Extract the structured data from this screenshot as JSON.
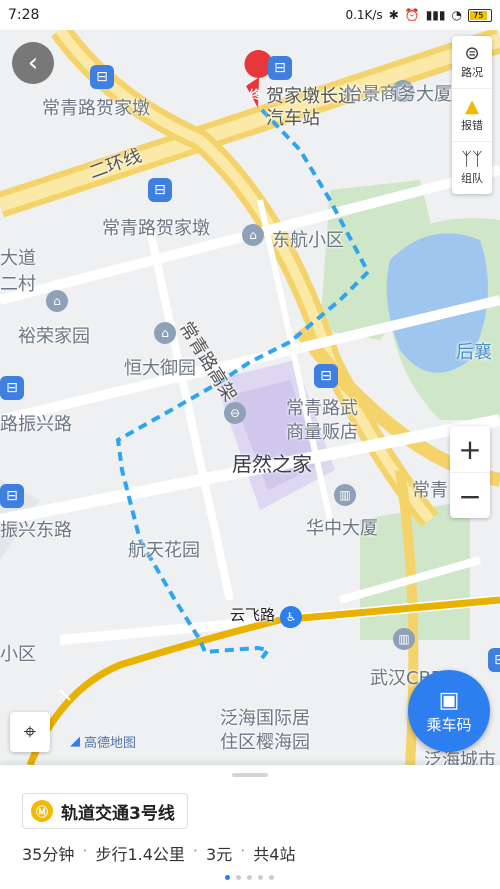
{
  "status": {
    "time": "7:28",
    "net_speed": "0.1K/s",
    "battery": "75"
  },
  "map": {
    "labels": {
      "changqing_hejiadun_1": "常青路贺家墩",
      "hejiadun_bus_station": "贺家墩长途汽车站",
      "yijing": "怡景商务大厦",
      "erhuanxian": "二环线",
      "changqing_hejiadun_2": "常青路贺家墩",
      "donghang": "东航小区",
      "dadao": "大道",
      "ercun": "二村",
      "yurong": "裕荣家园",
      "hengda": "恒大御园",
      "changqing_gaojia": "常青路高架",
      "houxiang": "后襄",
      "lu_zhenxing": "路振兴路",
      "changqing_wu": "常青路武",
      "shangliang": "商量贩店",
      "jurangzhijia": "居然之家",
      "changqing_right": "常青",
      "zhenxing_dong": "振兴东路",
      "hangtian": "航天花园",
      "huazhong": "华中大厦",
      "yunfei": "云飞路",
      "xiaoqu": "小区",
      "wuhan_cbd": "武汉CBD",
      "fanhai": "泛海国际居",
      "fanhai2": "住区樱海园",
      "fanhai_city": "泛海城市"
    },
    "end_marker": "终"
  },
  "controls": {
    "traffic": "路况",
    "report": "报错",
    "team": "组队",
    "zoom_in": "+",
    "zoom_out": "−",
    "logo": "高德地图",
    "ride_code": "乘车码"
  },
  "route": {
    "line_name": "轨道交通3号线",
    "duration": "35分钟",
    "walk": "步行1.4公里",
    "fare": "3元",
    "stops": "共4站"
  },
  "colors": {
    "route_blue": "#2ea5ef",
    "metro_yellow": "#e9b100",
    "accent": "#2d7ff0"
  }
}
